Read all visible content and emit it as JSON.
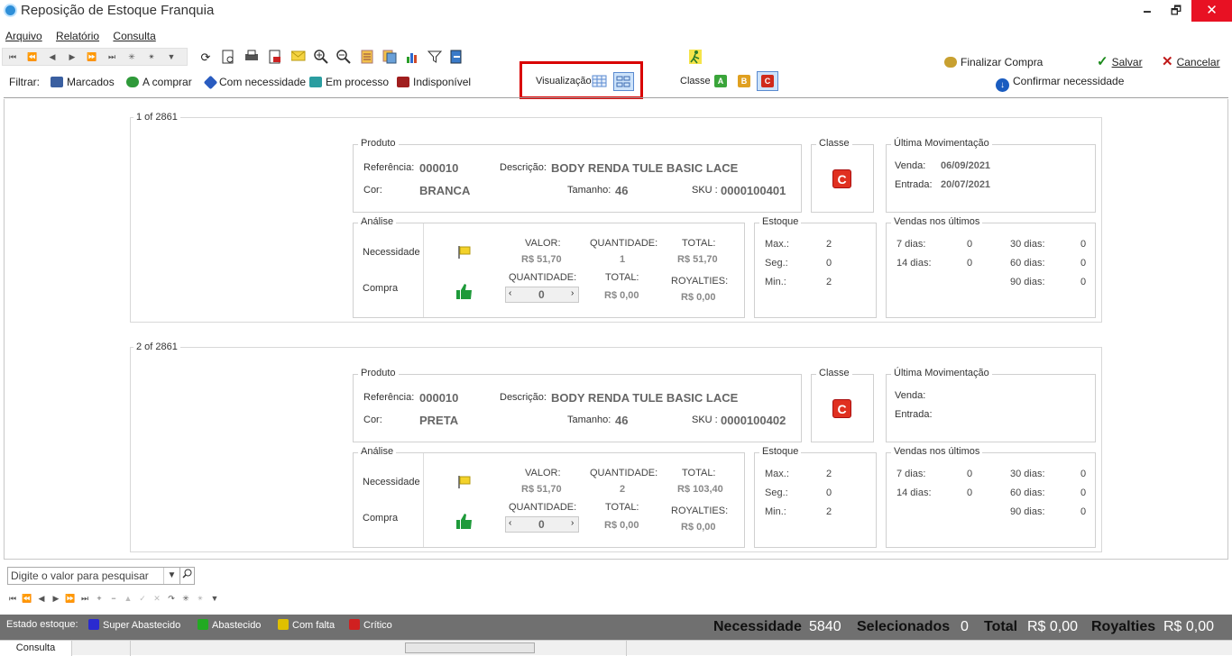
{
  "window": {
    "title": "Reposição de Estoque Franquia",
    "minimize": "🗕",
    "maximize": "🗗",
    "close": "✕"
  },
  "menu": [
    "Arquivo",
    "Relatório",
    "Consulta"
  ],
  "nav": [
    "⏮",
    "⏪",
    "◀",
    "▶",
    "⏩",
    "⏭",
    "✳",
    "✴",
    "▼"
  ],
  "filter": {
    "label": "Filtrar:",
    "items": [
      "Marcados",
      "A comprar",
      "Com necessidade",
      "Em processo",
      "Indisponível"
    ]
  },
  "view": {
    "label": "Visualização"
  },
  "classe": {
    "label": "Classe",
    "options": [
      "A",
      "B",
      "C"
    ]
  },
  "actions": {
    "finalize": "Finalizar Compra",
    "save": "Salvar",
    "cancel": "Cancelar",
    "confirm": "Confirmar necessidade"
  },
  "cards": [
    {
      "counter": "1 of 2861",
      "produto": {
        "group": "Produto",
        "ref_label": "Referência:",
        "ref": "000010",
        "desc_label": "Descrição:",
        "desc": "BODY RENDA TULE BASIC LACE",
        "cor_label": "Cor:",
        "cor": "BRANCA",
        "tam_label": "Tamanho:",
        "tam": "46",
        "sku_label": "SKU :",
        "sku": "0000100401"
      },
      "classe": {
        "group": "Classe",
        "value": "C"
      },
      "ultima": {
        "group": "Última Movimentação",
        "venda_label": "Venda:",
        "venda": "06/09/2021",
        "entrada_label": "Entrada:",
        "entrada": "20/07/2021"
      },
      "analise": {
        "group": "Análise",
        "necessidade": "Necessidade",
        "compra": "Compra",
        "valor_h": "VALOR:",
        "valor": "R$ 51,70",
        "qtd_h": "QUANTIDADE:",
        "qtd": "1",
        "total_h": "TOTAL:",
        "total": "R$ 51,70",
        "cq_h": "QUANTIDADE:",
        "cq": "0",
        "ct_h": "TOTAL:",
        "ct": "R$ 0,00",
        "roy_h": "ROYALTIES:",
        "roy": "R$ 0,00"
      },
      "estoque": {
        "group": "Estoque",
        "max_label": "Max.:",
        "max": "2",
        "seg_label": "Seg.:",
        "seg": "0",
        "min_label": "Min.:",
        "min": "2"
      },
      "vendas": {
        "group": "Vendas nos últimos",
        "d7_label": "7 dias:",
        "d7": "0",
        "d14_label": "14 dias:",
        "d14": "0",
        "d30_label": "30 dias:",
        "d30": "0",
        "d60_label": "60 dias:",
        "d60": "0",
        "d90_label": "90 dias:",
        "d90": "0"
      }
    },
    {
      "counter": "2 of 2861",
      "produto": {
        "group": "Produto",
        "ref_label": "Referência:",
        "ref": "000010",
        "desc_label": "Descrição:",
        "desc": "BODY RENDA TULE BASIC LACE",
        "cor_label": "Cor:",
        "cor": "PRETA",
        "tam_label": "Tamanho:",
        "tam": "46",
        "sku_label": "SKU :",
        "sku": "0000100402"
      },
      "classe": {
        "group": "Classe",
        "value": "C"
      },
      "ultima": {
        "group": "Última Movimentação",
        "venda_label": "Venda:",
        "venda": "",
        "entrada_label": "Entrada:",
        "entrada": ""
      },
      "analise": {
        "group": "Análise",
        "necessidade": "Necessidade",
        "compra": "Compra",
        "valor_h": "VALOR:",
        "valor": "R$ 51,70",
        "qtd_h": "QUANTIDADE:",
        "qtd": "2",
        "total_h": "TOTAL:",
        "total": "R$ 103,40",
        "cq_h": "QUANTIDADE:",
        "cq": "0",
        "ct_h": "TOTAL:",
        "ct": "R$ 0,00",
        "roy_h": "ROYALTIES:",
        "roy": "R$ 0,00"
      },
      "estoque": {
        "group": "Estoque",
        "max_label": "Max.:",
        "max": "2",
        "seg_label": "Seg.:",
        "seg": "0",
        "min_label": "Min.:",
        "min": "2"
      },
      "vendas": {
        "group": "Vendas nos últimos",
        "d7_label": "7 dias:",
        "d7": "0",
        "d14_label": "14 dias:",
        "d14": "0",
        "d30_label": "30 dias:",
        "d30": "0",
        "d60_label": "60 dias:",
        "d60": "0",
        "d90_label": "90 dias:",
        "d90": "0"
      }
    }
  ],
  "search": {
    "placeholder": "Digite o valor para pesquisar"
  },
  "gridnav": [
    "⏮",
    "⏪",
    "◀",
    "▶",
    "⏩",
    "⏭",
    "+",
    "−",
    "▲",
    "✓",
    "✕",
    "↷",
    "✳",
    "✴",
    "▼"
  ],
  "status": {
    "label": "Estado estoque:",
    "legend": [
      "Super Abastecido",
      "Abastecido",
      "Com falta",
      "Crítico"
    ],
    "legend_colors": [
      "#2a2ad0",
      "#22aa22",
      "#e0c000",
      "#d02020"
    ],
    "necessidade_label": "Necessidade",
    "necessidade": "5840",
    "sel_label": "Selecionados",
    "sel": "0",
    "total_label": "Total",
    "total": "R$ 0,00",
    "roy_label": "Royalties",
    "roy": "R$ 0,00"
  },
  "tab": "Consulta"
}
